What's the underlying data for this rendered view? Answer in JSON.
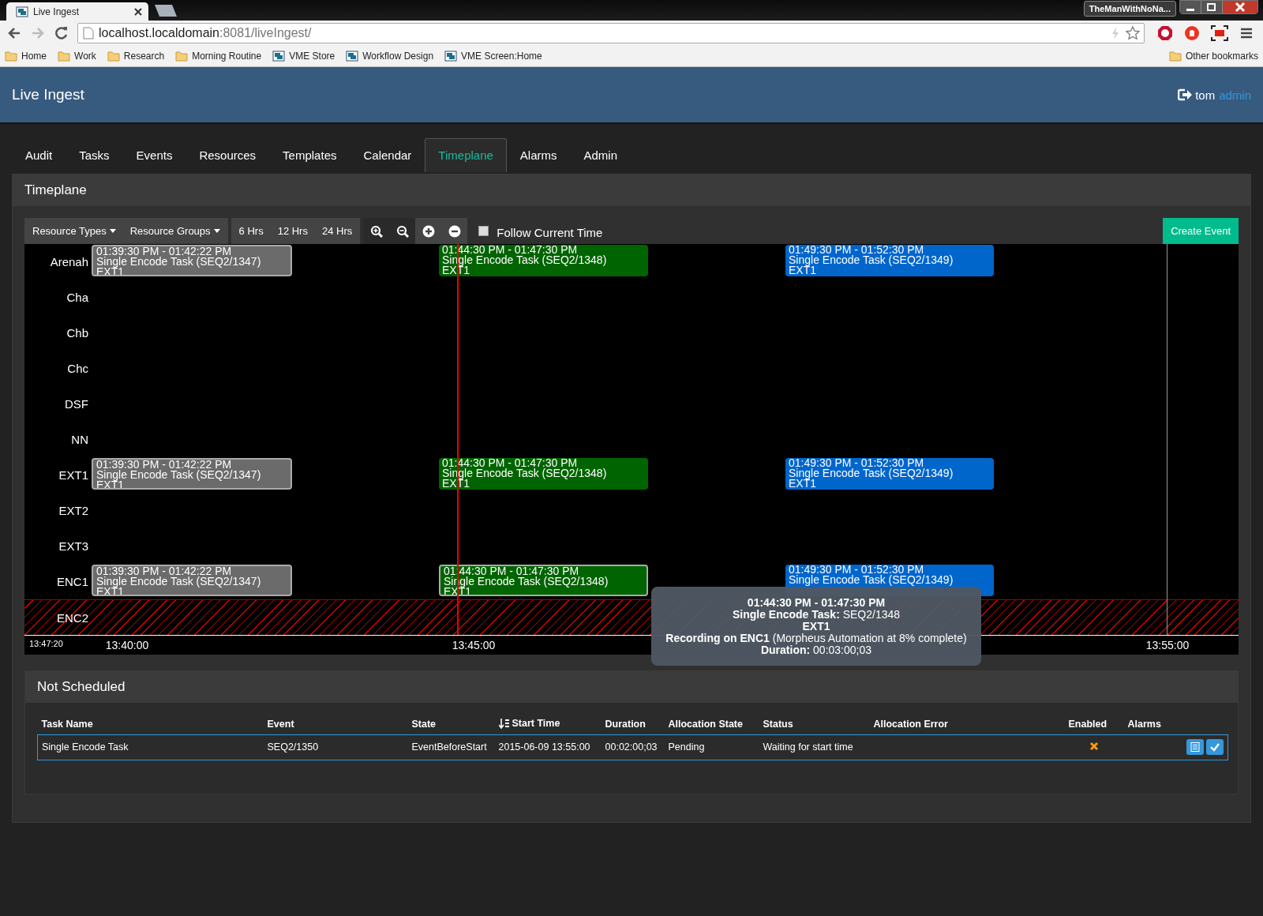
{
  "browser": {
    "tabs": [
      {
        "title": "Live Ingest",
        "selected": true
      }
    ],
    "profile_name": "TheManWithNoNa...",
    "address": {
      "host": "localhost.localdomain",
      "path": ":8081/liveIngest/"
    },
    "bookmarks": [
      {
        "label": "Home",
        "kind": "folder"
      },
      {
        "label": "Work",
        "kind": "folder"
      },
      {
        "label": "Research",
        "kind": "folder"
      },
      {
        "label": "Morning Routine",
        "kind": "folder"
      },
      {
        "label": "VME Store",
        "kind": "page"
      },
      {
        "label": "Workflow Design",
        "kind": "page"
      },
      {
        "label": "VME Screen:Home",
        "kind": "page"
      }
    ],
    "other_bookmarks": "Other bookmarks"
  },
  "app": {
    "title": "Live Ingest",
    "user": "tom",
    "role": "admin"
  },
  "nav": [
    {
      "label": "Audit",
      "selected": false
    },
    {
      "label": "Tasks",
      "selected": false
    },
    {
      "label": "Events",
      "selected": false
    },
    {
      "label": "Resources",
      "selected": false
    },
    {
      "label": "Templates",
      "selected": false
    },
    {
      "label": "Calendar",
      "selected": false
    },
    {
      "label": "Timeplane",
      "selected": true
    },
    {
      "label": "Alarms",
      "selected": false
    },
    {
      "label": "Admin",
      "selected": false
    }
  ],
  "timeplane": {
    "title": "Timeplane",
    "toolbar": {
      "dropdowns": [
        "Resource Types",
        "Resource Groups"
      ],
      "ranges": [
        "6 Hrs",
        "12 Hrs",
        "24 Hrs"
      ],
      "follow_current_time": {
        "label": "Follow Current Time",
        "checked": false
      },
      "create_button": "Create Event"
    },
    "rows": [
      {
        "label": "Arenah",
        "unavailable": false,
        "events": [
          {
            "time": "01:39:30 PM - 01:42:22 PM",
            "task": "Single Encode Task (SEQ2/1347)",
            "resource": "EXT1",
            "color": "#6b6b6b",
            "outlined": true
          },
          {
            "time": "01:44:30 PM - 01:47:30 PM",
            "task": "Single Encode Task (SEQ2/1348)",
            "resource": "EXT1",
            "color": "#006400",
            "outlined": false
          },
          {
            "time": "01:49:30 PM - 01:52:30 PM",
            "task": "Single Encode Task (SEQ2/1349)",
            "resource": "EXT1",
            "color": "#0066cc",
            "outlined": false
          }
        ]
      },
      {
        "label": "Cha",
        "unavailable": false
      },
      {
        "label": "Chb",
        "unavailable": false
      },
      {
        "label": "Chc",
        "unavailable": false
      },
      {
        "label": "DSF",
        "unavailable": false
      },
      {
        "label": "NN",
        "unavailable": false
      },
      {
        "label": "EXT1",
        "unavailable": false,
        "events": [
          {
            "time": "01:39:30 PM - 01:42:22 PM",
            "task": "Single Encode Task (SEQ2/1347)",
            "resource": "EXT1",
            "color": "#6b6b6b",
            "outlined": true
          },
          {
            "time": "01:44:30 PM - 01:47:30 PM",
            "task": "Single Encode Task (SEQ2/1348)",
            "resource": "EXT1",
            "color": "#006400",
            "outlined": false
          },
          {
            "time": "01:49:30 PM - 01:52:30 PM",
            "task": "Single Encode Task (SEQ2/1349)",
            "resource": "EXT1",
            "color": "#0066cc",
            "outlined": false
          }
        ]
      },
      {
        "label": "EXT2",
        "unavailable": false
      },
      {
        "label": "EXT3",
        "unavailable": false
      },
      {
        "label": "ENC1",
        "unavailable": false,
        "events": [
          {
            "time": "01:39:30 PM - 01:42:22 PM",
            "task": "Single Encode Task (SEQ2/1347)",
            "resource": "EXT1",
            "color": "#6b6b6b",
            "outlined": true
          },
          {
            "time": "01:44:30 PM - 01:47:30 PM",
            "task": "Single Encode Task (SEQ2/1348)",
            "resource": "EXT1",
            "color": "#006400",
            "outlined": true
          },
          {
            "time": "01:49:30 PM - 01:52:30 PM",
            "task": "Single Encode Task (SEQ2/1349)",
            "color": "#0066cc",
            "outlined": false
          }
        ]
      },
      {
        "label": "ENC2",
        "unavailable": true
      }
    ],
    "current_time": "13:47:20",
    "ticks": [
      "13:40:00",
      "13:45:00",
      "13:55:00"
    ],
    "tooltip": {
      "lines": [
        "**01:44:30 PM - 01:47:30 PM**",
        "**Single Encode Task:** SEQ2/1348",
        "**EXT1**",
        "**Recording on ENC1** (Morpheus Automation at 8% complete)",
        "**Duration:** 00:03:00;03"
      ]
    }
  },
  "not_scheduled": {
    "title": "Not Scheduled",
    "columns": [
      {
        "label": "Task Name",
        "sorted": false
      },
      {
        "label": "Event",
        "sorted": false
      },
      {
        "label": "State",
        "sorted": false
      },
      {
        "label": "Start Time",
        "sorted": true
      },
      {
        "label": "Duration",
        "sorted": false
      },
      {
        "label": "Allocation State",
        "sorted": false
      },
      {
        "label": "Status",
        "sorted": false
      },
      {
        "label": "Allocation Error",
        "sorted": false
      },
      {
        "label": "Enabled",
        "sorted": false
      },
      {
        "label": "Alarms",
        "sorted": false
      }
    ],
    "rows": [
      {
        "cells": [
          "Single Encode Task",
          "SEQ2/1350",
          "EventBeforeStart",
          "2015-06-09 13:55:00",
          "00:02:00;03",
          "Pending",
          "Waiting for start time"
        ],
        "enabled": false
      }
    ]
  }
}
